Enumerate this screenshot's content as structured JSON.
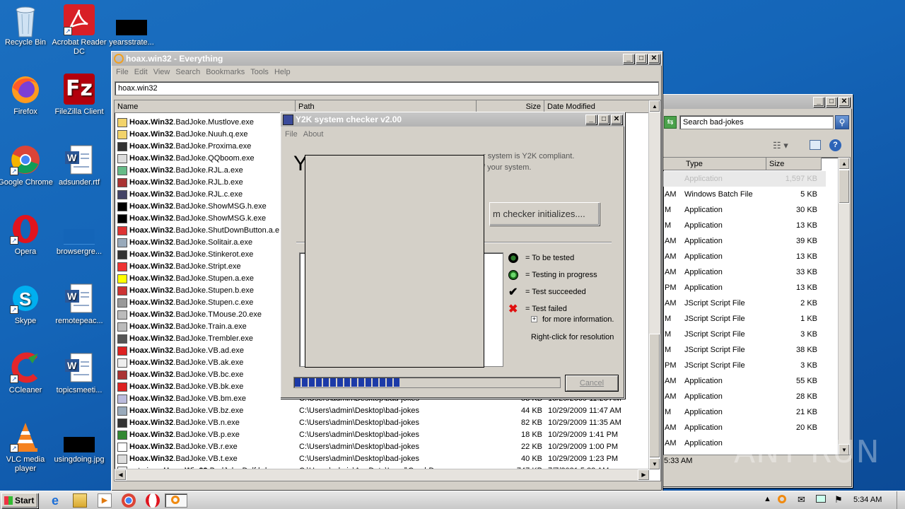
{
  "desktop": {
    "icons": [
      {
        "label": "Recycle Bin"
      },
      {
        "label": "Acrobat Reader DC"
      },
      {
        "label": "yearsstrate..."
      },
      {
        "label": "Firefox"
      },
      {
        "label": "FileZilla Client"
      },
      {
        "label": "Google Chrome"
      },
      {
        "label": "adsunder.rtf"
      },
      {
        "label": "Opera"
      },
      {
        "label": "browsergre..."
      },
      {
        "label": "Skype"
      },
      {
        "label": "remotepeac..."
      },
      {
        "label": "CCleaner"
      },
      {
        "label": "topicsmeeti..."
      },
      {
        "label": "VLC media player"
      },
      {
        "label": "usingdoing.jpg"
      }
    ]
  },
  "everything": {
    "title": "hoax.win32 - Everything",
    "menu": [
      "File",
      "Edit",
      "View",
      "Search",
      "Bookmarks",
      "Tools",
      "Help"
    ],
    "search_value": "hoax.win32",
    "columns": {
      "name": "Name",
      "path": "Path",
      "size": "Size",
      "date": "Date Modified"
    },
    "rows": [
      {
        "bold": "Hoax.Win32",
        "rest": ".BadJoke.Mustlove.exe",
        "path": "",
        "size": "",
        "date": ""
      },
      {
        "bold": "Hoax.Win32",
        "rest": ".BadJoke.Nuuh.q.exe",
        "path": "",
        "size": "",
        "date": ""
      },
      {
        "bold": "Hoax.Win32",
        "rest": ".BadJoke.Proxima.exe",
        "path": "",
        "size": "",
        "date": ""
      },
      {
        "bold": "Hoax.Win32",
        "rest": ".BadJoke.QQboom.exe",
        "path": "",
        "size": "",
        "date": ""
      },
      {
        "bold": "Hoax.Win32",
        "rest": ".BadJoke.RJL.a.exe",
        "path": "",
        "size": "",
        "date": ""
      },
      {
        "bold": "Hoax.Win32",
        "rest": ".BadJoke.RJL.b.exe",
        "path": "",
        "size": "",
        "date": ""
      },
      {
        "bold": "Hoax.Win32",
        "rest": ".BadJoke.RJL.c.exe",
        "path": "",
        "size": "",
        "date": ""
      },
      {
        "bold": "Hoax.Win32",
        "rest": ".BadJoke.ShowMSG.h.exe",
        "path": "",
        "size": "",
        "date": ""
      },
      {
        "bold": "Hoax.Win32",
        "rest": ".BadJoke.ShowMSG.k.exe",
        "path": "",
        "size": "",
        "date": ""
      },
      {
        "bold": "Hoax.Win32",
        "rest": ".BadJoke.ShutDownButton.a.e",
        "path": "",
        "size": "",
        "date": ""
      },
      {
        "bold": "Hoax.Win32",
        "rest": ".BadJoke.Solitair.a.exe",
        "path": "",
        "size": "",
        "date": ""
      },
      {
        "bold": "Hoax.Win32",
        "rest": ".BadJoke.Stinkerot.exe",
        "path": "",
        "size": "",
        "date": ""
      },
      {
        "bold": "Hoax.Win32",
        "rest": ".BadJoke.Stript.exe",
        "path": "",
        "size": "",
        "date": ""
      },
      {
        "bold": "Hoax.Win32",
        "rest": ".BadJoke.Stupen.a.exe",
        "path": "",
        "size": "",
        "date": ""
      },
      {
        "bold": "Hoax.Win32",
        "rest": ".BadJoke.Stupen.b.exe",
        "path": "",
        "size": "",
        "date": ""
      },
      {
        "bold": "Hoax.Win32",
        "rest": ".BadJoke.Stupen.c.exe",
        "path": "",
        "size": "",
        "date": ""
      },
      {
        "bold": "Hoax.Win32",
        "rest": ".BadJoke.TMouse.20.exe",
        "path": "",
        "size": "",
        "date": ""
      },
      {
        "bold": "Hoax.Win32",
        "rest": ".BadJoke.Train.a.exe",
        "path": "",
        "size": "",
        "date": ""
      },
      {
        "bold": "Hoax.Win32",
        "rest": ".BadJoke.Trembler.exe",
        "path": "",
        "size": "",
        "date": ""
      },
      {
        "bold": "Hoax.Win32",
        "rest": ".BadJoke.VB.ad.exe",
        "path": "",
        "size": "",
        "date": ""
      },
      {
        "bold": "Hoax.Win32",
        "rest": ".BadJoke.VB.ak.exe",
        "path": "",
        "size": "",
        "date": ""
      },
      {
        "bold": "Hoax.Win32",
        "rest": ".BadJoke.VB.bc.exe",
        "path": "",
        "size": "",
        "date": ""
      },
      {
        "bold": "Hoax.Win32",
        "rest": ".BadJoke.VB.bk.exe",
        "path": "",
        "size": "",
        "date": ""
      },
      {
        "bold": "Hoax.Win32",
        "rest": ".BadJoke.VB.bm.exe",
        "path": "C:\\Users\\admin\\Desktop\\bad-jokes",
        "size": "53 KB",
        "date": "10/29/2009 11:20 AM"
      },
      {
        "bold": "Hoax.Win32",
        "rest": ".BadJoke.VB.bz.exe",
        "path": "C:\\Users\\admin\\Desktop\\bad-jokes",
        "size": "44 KB",
        "date": "10/29/2009 11:47 AM"
      },
      {
        "bold": "Hoax.Win32",
        "rest": ".BadJoke.VB.n.exe",
        "path": "C:\\Users\\admin\\Desktop\\bad-jokes",
        "size": "82 KB",
        "date": "10/29/2009 11:35 AM"
      },
      {
        "bold": "Hoax.Win32",
        "rest": ".BadJoke.VB.p.exe",
        "path": "C:\\Users\\admin\\Desktop\\bad-jokes",
        "size": "18 KB",
        "date": "10/29/2009 1:41 PM"
      },
      {
        "bold": "Hoax.Win32",
        "rest": ".BadJoke.VB.r.exe",
        "path": "C:\\Users\\admin\\Desktop\\bad-jokes",
        "size": "22 KB",
        "date": "10/29/2009 1:00 PM"
      },
      {
        "bold": "Hoax.Win32",
        "rest": ".BadJoke.VB.t.exe",
        "path": "C:\\Users\\admin\\Desktop\\bad-jokes",
        "size": "40 KB",
        "date": "10/29/2009 1:23 PM"
      },
      {
        "prefix": "not-virus_",
        "bold": "Hoax.Win32",
        "rest": ".BadJoke.Delf.bd.ex...",
        "path": "C:\\Users\\admin\\AppData\\Local\\CrashDumps",
        "size": "747 KB",
        "date": "7/7/2021 5:33 AM"
      }
    ]
  },
  "explorer": {
    "search_placeholder": "Search bad-jokes",
    "columns": {
      "type": "Type",
      "size": "Size"
    },
    "rows": [
      {
        "c1": "",
        "type": "Application",
        "size": "1,597 KB"
      },
      {
        "c1": "AM",
        "type": "Windows Batch File",
        "size": "5 KB"
      },
      {
        "c1": "M",
        "type": "Application",
        "size": "30 KB"
      },
      {
        "c1": "M",
        "type": "Application",
        "size": "13 KB"
      },
      {
        "c1": "AM",
        "type": "Application",
        "size": "39 KB"
      },
      {
        "c1": "AM",
        "type": "Application",
        "size": "13 KB"
      },
      {
        "c1": "AM",
        "type": "Application",
        "size": "33 KB"
      },
      {
        "c1": "PM",
        "type": "Application",
        "size": "13 KB"
      },
      {
        "c1": "AM",
        "type": "JScript Script File",
        "size": "2 KB"
      },
      {
        "c1": "M",
        "type": "JScript Script File",
        "size": "1 KB"
      },
      {
        "c1": "M",
        "type": "JScript Script File",
        "size": "3 KB"
      },
      {
        "c1": "M",
        "type": "JScript Script File",
        "size": "38 KB"
      },
      {
        "c1": "PM",
        "type": "JScript Script File",
        "size": "3 KB"
      },
      {
        "c1": "AM",
        "type": "Application",
        "size": "55 KB"
      },
      {
        "c1": "AM",
        "type": "Application",
        "size": "28 KB"
      },
      {
        "c1": "M",
        "type": "Application",
        "size": "21 KB"
      },
      {
        "c1": "AM",
        "type": "Application",
        "size": "20 KB"
      },
      {
        "c1": "AM",
        "type": "Application",
        "size": ""
      }
    ],
    "status": "5:33 AM"
  },
  "y2k": {
    "title": "Y2K system checker v2.00",
    "menu": [
      "File",
      "About"
    ],
    "big_letter": "Y",
    "desc_line1": "r system is Y2K compliant.",
    "desc_line2": "f your system.",
    "status_button": "m checker initializes....",
    "legend": [
      "= To be tested",
      "= Testing in progress",
      "= Test succeeded",
      "= Test failed"
    ],
    "more_info": "for more information.",
    "right_click": "Right-click for resolution",
    "cancel": "Cancel",
    "progress": 0.4
  },
  "taskbar": {
    "start": "Start",
    "clock": "5:34 AM"
  },
  "watermark": "ANY RUN"
}
